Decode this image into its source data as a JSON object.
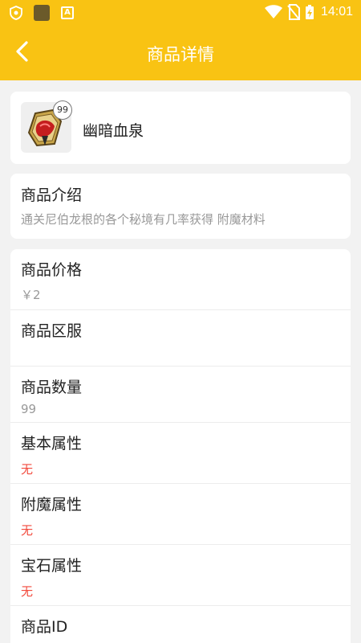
{
  "status_bar": {
    "time": "14:01",
    "square_color": "#6b5a2a"
  },
  "header": {
    "title": "商品详情",
    "background": "#f9c313"
  },
  "product": {
    "name": "幽暗血泉",
    "quantity_badge": "99"
  },
  "intro": {
    "label": "商品介绍",
    "value": "通关尼伯龙根的各个秘境有几率获得 附魔材料"
  },
  "details": [
    {
      "label": "商品价格",
      "value": "￥2",
      "style": "gray"
    },
    {
      "label": "商品区服",
      "value": "",
      "style": "gray"
    },
    {
      "label": "商品数量",
      "value": "99",
      "style": "gray"
    },
    {
      "label": "基本属性",
      "value": "无",
      "style": "red"
    },
    {
      "label": "附魔属性",
      "value": "无",
      "style": "red"
    },
    {
      "label": "宝石属性",
      "value": "无",
      "style": "red"
    },
    {
      "label": "商品ID",
      "value": "",
      "style": "gray"
    }
  ],
  "colors": {
    "accent": "#f9c313",
    "red_value": "#f24a3d",
    "gray_value": "#999999"
  }
}
